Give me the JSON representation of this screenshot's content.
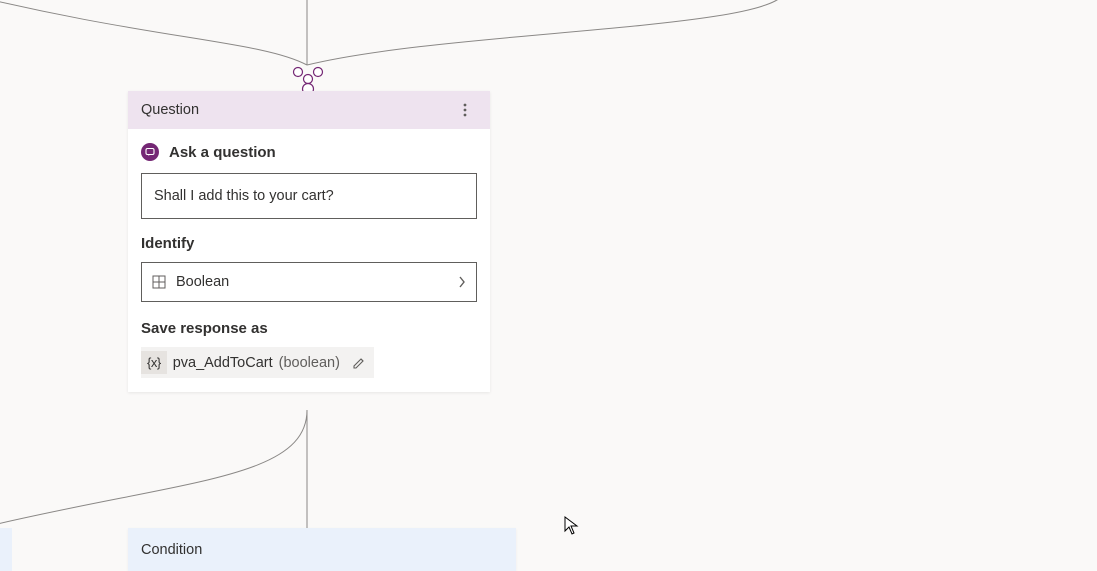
{
  "question_node": {
    "header_title": "Question",
    "action_label": "Ask a question",
    "prompt_text": "Shall I add this to your cart?",
    "identify_label": "Identify",
    "identify_type": "Boolean",
    "save_label": "Save response as",
    "variable_name": "pva_AddToCart",
    "variable_type": "(boolean)",
    "variable_prefix": "{x}"
  },
  "condition_node": {
    "header_title": "Condition"
  }
}
